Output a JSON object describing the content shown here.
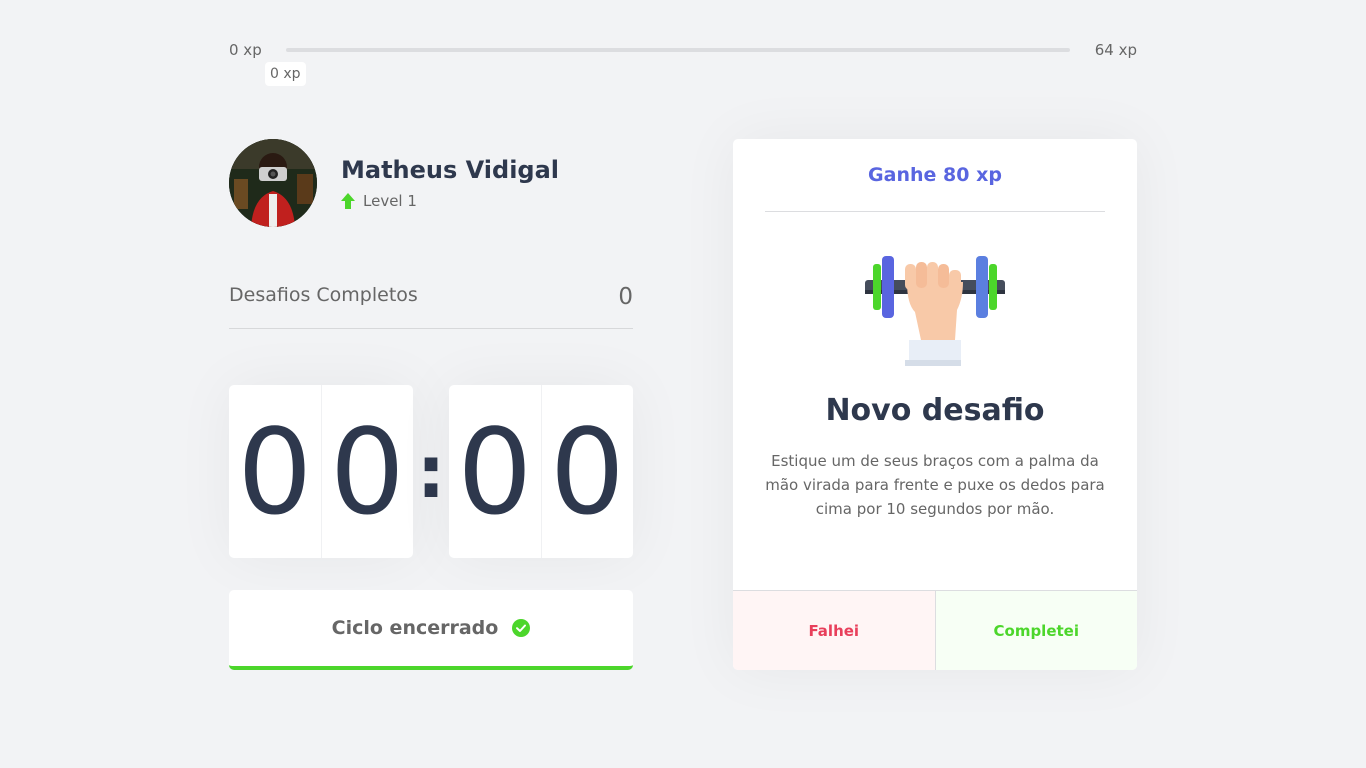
{
  "xp_bar": {
    "min_label": "0 xp",
    "max_label": "64 xp",
    "current_label": "0 xp",
    "progress_fraction": 0
  },
  "profile": {
    "name": "Matheus Vidigal",
    "level": "Level 1",
    "avatar_icon": "user-photo"
  },
  "completed_challenges": {
    "label": "Desafios Completos",
    "count": "0"
  },
  "countdown": {
    "minute_left": "0",
    "minute_right": "0",
    "separator": ":",
    "second_left": "0",
    "second_right": "0"
  },
  "cycle_button": {
    "label": "Ciclo encerrado",
    "icon": "check-circle-icon"
  },
  "challenge": {
    "reward": "Ganhe 80 xp",
    "icon": "dumbbell-icon",
    "title": "Novo desafio",
    "description": "Estique um de seus braços com a palma da mão virada para frente e puxe os dedos para cima por 10 segundos por mão.",
    "failed_label": "Falhei",
    "succeeded_label": "Completei"
  },
  "colors": {
    "background": "#f2f3f5",
    "text": "#666666",
    "title": "#2e384d",
    "blue": "#5965e0",
    "green": "#4cd62b",
    "red": "#e83f5b"
  }
}
